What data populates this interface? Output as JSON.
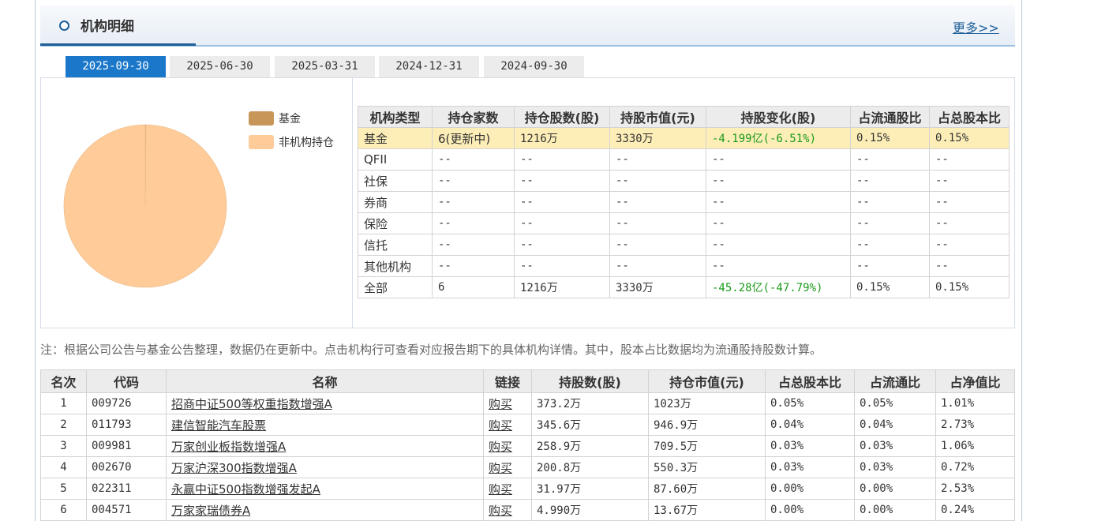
{
  "header": {
    "title": "机构明细",
    "more_label": "更多>>"
  },
  "tabs": [
    "2025-09-30",
    "2025-06-30",
    "2025-03-31",
    "2024-12-31",
    "2024-09-30"
  ],
  "active_tab": 0,
  "chart_data": {
    "type": "pie",
    "labels": [
      "基金",
      "非机构持仓"
    ],
    "values": [
      0.15,
      99.85
    ],
    "colors": [
      "#c9965a",
      "#ffcc99"
    ]
  },
  "inst_table": {
    "headers": [
      "机构类型",
      "持仓家数",
      "持仓股数(股)",
      "持股市值(元)",
      "持股变化(股)",
      "占流通股比",
      "占总股本比"
    ],
    "rows": [
      [
        "基金",
        "6(更新中)",
        "1216万",
        "3330万",
        "-4.199亿(-6.51%)",
        "0.15%",
        "0.15%"
      ],
      [
        "QFII",
        "--",
        "--",
        "--",
        "--",
        "--",
        "--"
      ],
      [
        "社保",
        "--",
        "--",
        "--",
        "--",
        "--",
        "--"
      ],
      [
        "券商",
        "--",
        "--",
        "--",
        "--",
        "--",
        "--"
      ],
      [
        "保险",
        "--",
        "--",
        "--",
        "--",
        "--",
        "--"
      ],
      [
        "信托",
        "--",
        "--",
        "--",
        "--",
        "--",
        "--"
      ],
      [
        "其他机构",
        "--",
        "--",
        "--",
        "--",
        "--",
        "--"
      ],
      [
        "全部",
        "6",
        "1216万",
        "3330万",
        "-45.28亿(-47.79%)",
        "0.15%",
        "0.15%"
      ]
    ]
  },
  "note": "注：根据公司公告与基金公告整理，数据仍在更新中。点击机构行可查看对应报告期下的具体机构详情。其中，股本占比数据均为流通股持股数计算。",
  "fund_table": {
    "headers": [
      "名次",
      "代码",
      "名称",
      "链接",
      "持股数(股)",
      "持仓市值(元)",
      "占总股本比",
      "占流通比",
      "占净值比"
    ],
    "rows": [
      [
        "1",
        "009726",
        "招商中证500等权重指数增强A",
        "购买",
        "373.2万",
        "1023万",
        "0.05%",
        "0.05%",
        "1.01%"
      ],
      [
        "2",
        "011793",
        "建信智能汽车股票",
        "购买",
        "345.6万",
        "946.9万",
        "0.04%",
        "0.04%",
        "2.73%"
      ],
      [
        "3",
        "009981",
        "万家创业板指数增强A",
        "购买",
        "258.9万",
        "709.5万",
        "0.03%",
        "0.03%",
        "1.06%"
      ],
      [
        "4",
        "002670",
        "万家沪深300指数增强A",
        "购买",
        "200.8万",
        "550.3万",
        "0.03%",
        "0.03%",
        "0.72%"
      ],
      [
        "5",
        "022311",
        "永赢中证500指数增强发起A",
        "购买",
        "31.97万",
        "87.60万",
        "0.00%",
        "0.00%",
        "2.53%"
      ],
      [
        "6",
        "004571",
        "万家家瑞债券A",
        "购买",
        "4.990万",
        "13.67万",
        "0.00%",
        "0.00%",
        "0.24%"
      ]
    ]
  }
}
